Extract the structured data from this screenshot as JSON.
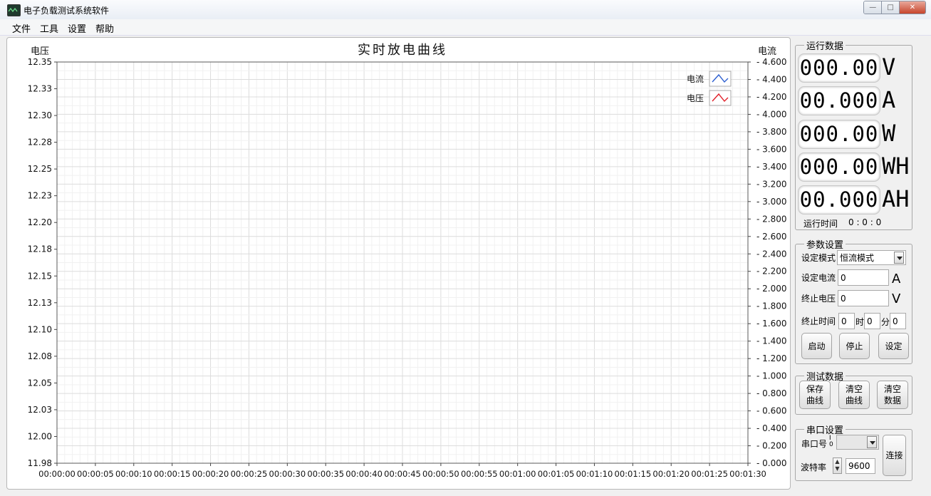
{
  "window": {
    "title": "电子负载测试系统软件"
  },
  "menu": [
    "文件",
    "工具",
    "设置",
    "帮助"
  ],
  "chart_data": {
    "type": "line",
    "title": "实时放电曲线",
    "ylabel_left": "电压",
    "ylabel_right": "电流",
    "yticks_left": [
      "12.35",
      "12.33",
      "12.30",
      "12.28",
      "12.25",
      "12.23",
      "12.20",
      "12.18",
      "12.15",
      "12.13",
      "12.10",
      "12.08",
      "12.05",
      "12.03",
      "12.00",
      "11.98"
    ],
    "ylim_left": [
      11.98,
      12.35
    ],
    "yticks_right": [
      "4.600",
      "4.400",
      "4.200",
      "4.000",
      "3.800",
      "3.600",
      "3.400",
      "3.200",
      "3.000",
      "2.800",
      "2.600",
      "2.400",
      "2.200",
      "2.000",
      "1.800",
      "1.600",
      "1.400",
      "1.200",
      "1.000",
      "0.800",
      "0.600",
      "0.400",
      "0.200",
      "0.000"
    ],
    "ylim_right": [
      0,
      4.6
    ],
    "xticks": [
      "00:00:00",
      "00:00:05",
      "00:00:10",
      "00:00:15",
      "00:00:20",
      "00:00:25",
      "00:00:30",
      "00:00:35",
      "00:00:40",
      "00:00:45",
      "00:00:50",
      "00:00:55",
      "00:01:00",
      "00:01:05",
      "00:01:10",
      "00:01:15",
      "00:01:20",
      "00:01:25",
      "00:01:30"
    ],
    "legend_position": "top-right",
    "series": [
      {
        "name": "电流",
        "color": "#2d5fd0",
        "values": []
      },
      {
        "name": "电压",
        "color": "#e0202a",
        "values": []
      }
    ],
    "grid": true
  },
  "running": {
    "legend": "运行数据",
    "readouts": [
      {
        "value": "000.00",
        "unit": "V"
      },
      {
        "value": "00.000",
        "unit": "A"
      },
      {
        "value": "000.00",
        "unit": "W"
      },
      {
        "value": "000.00",
        "unit": "WH"
      },
      {
        "value": "00.000",
        "unit": "AH"
      }
    ],
    "runtime_label": "运行时间",
    "runtime_value": "0 : 0 : 0"
  },
  "params": {
    "legend": "参数设置",
    "mode_label": "设定模式",
    "mode_value": "恒流模式",
    "current_label": "设定电流",
    "current_value": "0",
    "current_unit": "A",
    "voltage_label": "终止电压",
    "voltage_value": "0",
    "voltage_unit": "V",
    "time_label": "终止时间",
    "time_h": "0",
    "time_h_unit": "时",
    "time_m": "0",
    "time_m_unit": "分",
    "time_s": "0",
    "btn_start": "启动",
    "btn_stop": "停止",
    "btn_set": "设定"
  },
  "testdata": {
    "legend": "测试数据",
    "btn_save_curve": "保存\n曲线",
    "btn_clear_curve": "清空\n曲线",
    "btn_clear_data": "清空\n数据"
  },
  "serial": {
    "legend": "串口设置",
    "port_label": "串口号",
    "port_value": "",
    "baud_label": "波特率",
    "baud_value": "9600",
    "btn_connect": "连接"
  }
}
